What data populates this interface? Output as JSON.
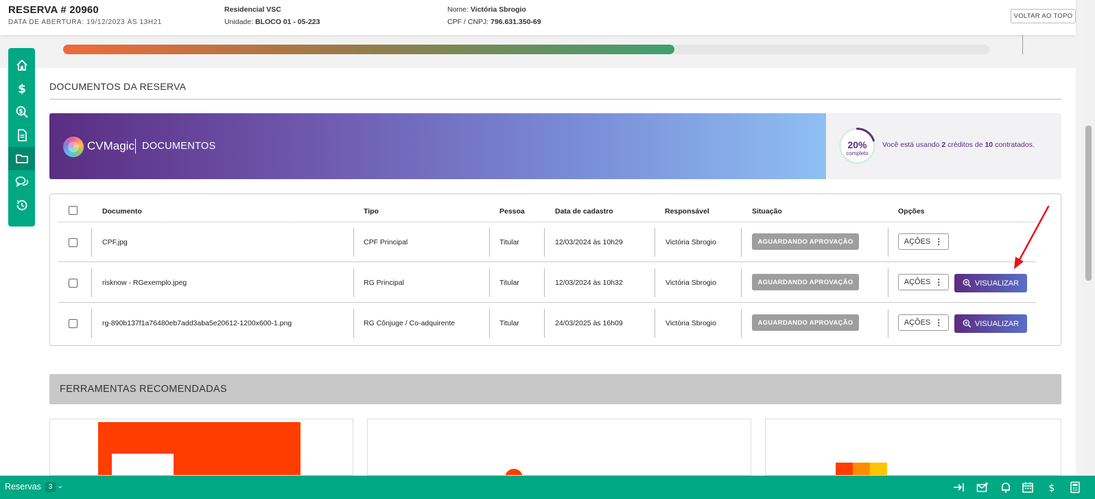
{
  "header": {
    "reserva_title": "RESERVA # 20960",
    "abertura": "DATA DE ABERTURA: 19/12/2023 ÀS 13H21",
    "empreendimento": "Residencial VSC",
    "unidade_label": "Unidade:",
    "unidade_value": "BLOCO 01 - 05-223",
    "nome_label": "Nome:",
    "nome_value": "Victória Sbrogio",
    "cpf_label": "CPF / CNPJ:",
    "cpf_value": "796.631.350-69",
    "top_button": "VOLTAR AO TOPO"
  },
  "progress": {
    "value": 0.66
  },
  "sidebar": {
    "items": [
      {
        "name": "home",
        "icon": "home-icon"
      },
      {
        "name": "financeiro",
        "icon": "dollar-icon"
      },
      {
        "name": "simulacao",
        "icon": "search-dollar-icon"
      },
      {
        "name": "contrato",
        "icon": "document-icon"
      },
      {
        "name": "documentos",
        "icon": "folder-icon",
        "active": true
      },
      {
        "name": "mensagens",
        "icon": "chat-icon"
      },
      {
        "name": "historico",
        "icon": "history-icon"
      }
    ]
  },
  "documents": {
    "section_title": "DOCUMENTOS DA RESERVA",
    "banner": {
      "brand": "CVMagic",
      "label": "DOCUMENTOS",
      "percent": "20%",
      "percent_label": "completo",
      "percent_value": 0.2,
      "credits_prefix": "Você está usando",
      "credits_used": "2",
      "credits_mid": "créditos de",
      "credits_total": "10",
      "credits_suffix": "contratados."
    },
    "columns": [
      "Documento",
      "Tipo",
      "Pessoa",
      "Data de cadastro",
      "Responsável",
      "Situação",
      "Opções"
    ],
    "rows": [
      {
        "documento": "CPF.jpg",
        "tipo": "CPF Principal",
        "pessoa": "Titular",
        "data": "12/03/2024 às 10h29",
        "responsavel": "Victória Sbrogio",
        "situacao": "AGUARDANDO APROVAÇÃO",
        "acoes": "AÇÕES",
        "visualizar": ""
      },
      {
        "documento": "risknow - RGexemplo.jpeg",
        "tipo": "RG Principal",
        "pessoa": "Titular",
        "data": "12/03/2024 às 10h32",
        "responsavel": "Victória Sbrogio",
        "situacao": "AGUARDANDO APROVAÇÃO",
        "acoes": "AÇÕES",
        "visualizar": "VISUALIZAR"
      },
      {
        "documento": "rg-890b137f1a76480eb7add3aba5e20612-1200x600-1.png",
        "tipo": "RG Cônjuge / Co-adquirente",
        "pessoa": "Titular",
        "data": "24/03/2025 às 16h09",
        "responsavel": "Victória Sbrogio",
        "situacao": "AGUARDANDO APROVAÇÃO",
        "acoes": "AÇÕES",
        "visualizar": "VISUALIZAR"
      }
    ]
  },
  "tools": {
    "title": "FERRAMENTAS RECOMENDADAS"
  },
  "bottombar": {
    "label": "Reservas",
    "count": "3",
    "icons": [
      "expand-right-icon",
      "mail-star-icon",
      "bell-icon",
      "calendar-icon",
      "dollar-icon",
      "calculator-icon"
    ]
  },
  "colors": {
    "accent": "#00a884",
    "brand": "#5a2d82",
    "status": "#9e9e9e",
    "arrow": "#e5141b"
  }
}
